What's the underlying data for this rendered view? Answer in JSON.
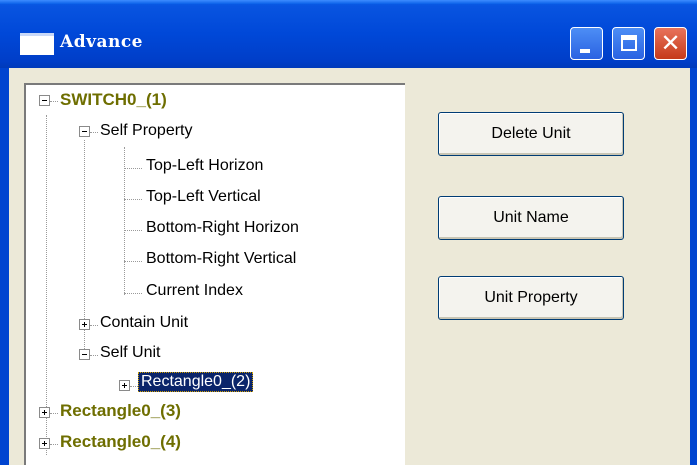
{
  "window": {
    "title": "Advance",
    "icons": {
      "app": "window-icon",
      "minimize": "minimize-icon",
      "maximize": "maximize-icon",
      "close": "close-icon"
    },
    "close_glyph": "✕"
  },
  "tree": {
    "root1": "SWITCH0_(1)",
    "self_property": "Self Property",
    "props": [
      "Top-Left Horizon",
      "Top-Left Vertical",
      "Bottom-Right Horizon",
      "Bottom-Right Vertical",
      "Current Index"
    ],
    "contain_unit": "Contain Unit",
    "self_unit": "Self Unit",
    "selected_child": "Rectangle0_(2)",
    "root2": "Rectangle0_(3)",
    "root3": "Rectangle0_(4)"
  },
  "buttons": {
    "delete": "Delete Unit",
    "name": "Unit Name",
    "property": "Unit Property"
  }
}
